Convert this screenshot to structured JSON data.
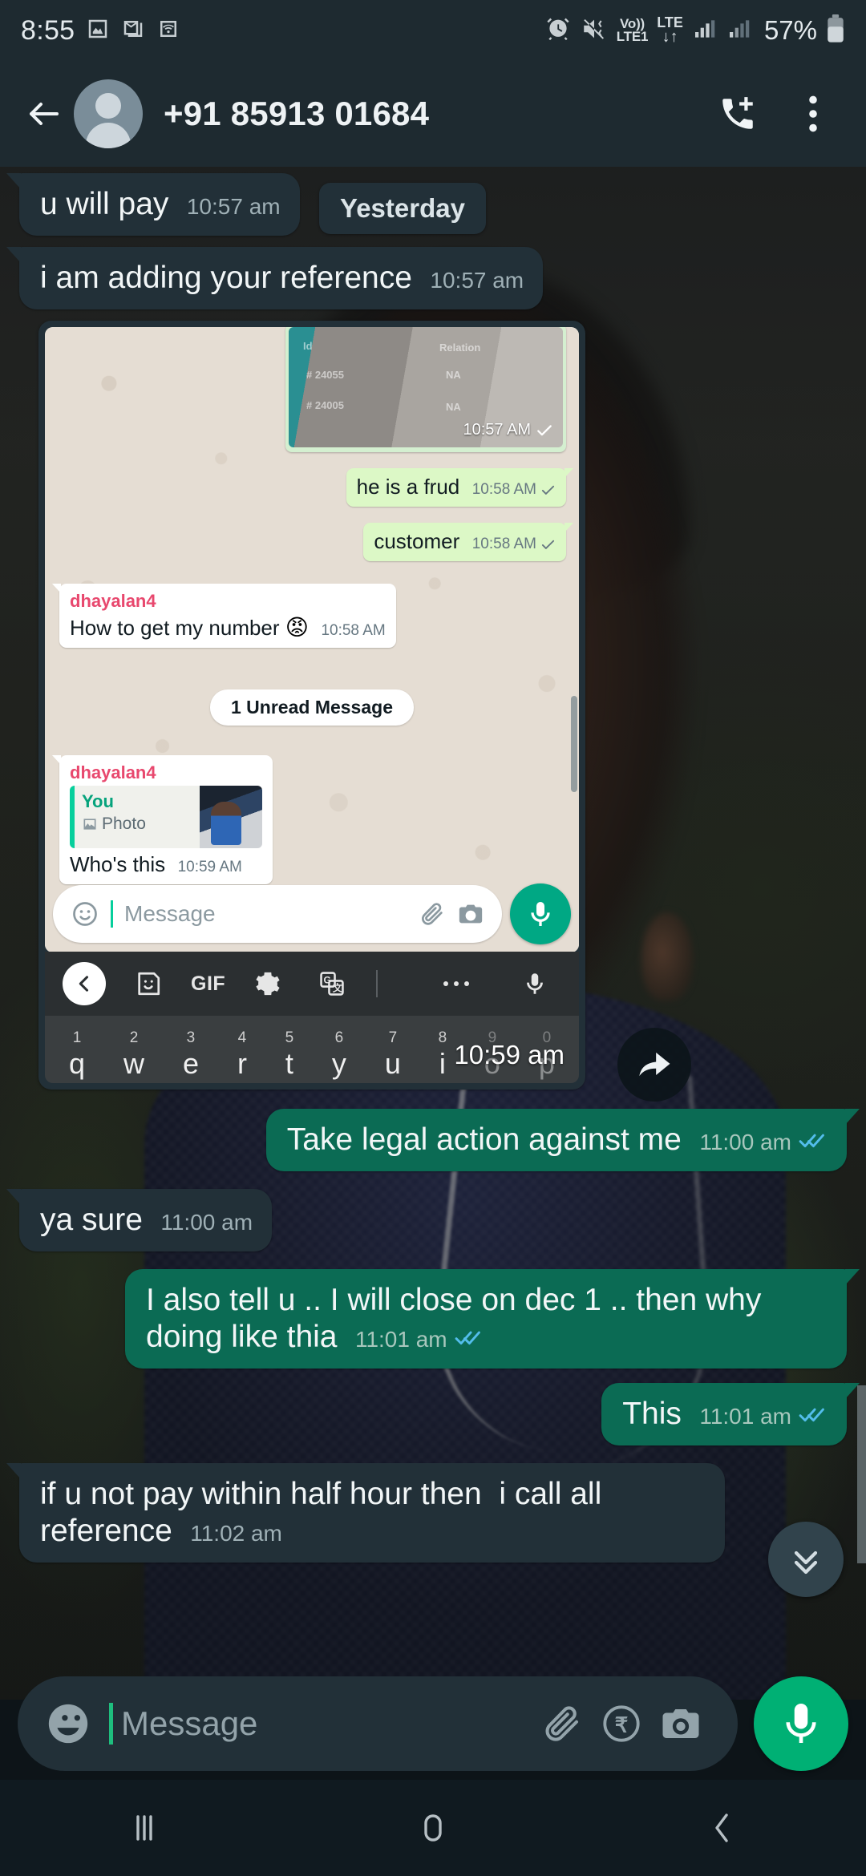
{
  "status_bar": {
    "time": "8:55",
    "icons_left": [
      "gallery-icon",
      "mail-icon",
      "wifi-icon"
    ],
    "icons_right": [
      "alarm-icon",
      "vibrate-icon",
      "volte-icon",
      "lte-data-icon",
      "signal-sim1-icon",
      "signal-sim2-icon"
    ],
    "volte_top": "Vo))",
    "volte_bottom": "LTE1",
    "lte_top": "LTE",
    "battery_percent": "57%"
  },
  "header": {
    "back_icon": "back-arrow-icon",
    "contact_name": "+91 85913 01684",
    "call_icon": "call-add-icon",
    "menu_icon": "overflow-menu-icon"
  },
  "chat": {
    "day_divider": "Yesterday",
    "messages": [
      {
        "id": "m1",
        "dir": "in",
        "text": "u will pay",
        "time": "10:57 am"
      },
      {
        "id": "m2",
        "dir": "in",
        "text": "i am adding your reference",
        "time": "10:57 am"
      },
      {
        "id": "m3",
        "dir": "in",
        "type": "image",
        "time": "10:59 am"
      },
      {
        "id": "m4",
        "dir": "out",
        "text": "Take legal action against me",
        "time": "11:00 am",
        "status": "read"
      },
      {
        "id": "m5",
        "dir": "in",
        "text": "ya sure",
        "time": "11:00 am"
      },
      {
        "id": "m6",
        "dir": "out",
        "text": "I also tell u .. I will close on dec 1 .. then why doing like thia",
        "time": "11:01 am",
        "status": "read"
      },
      {
        "id": "m7",
        "dir": "out",
        "text": "This",
        "time": "11:01 am",
        "status": "read"
      },
      {
        "id": "m8",
        "dir": "in",
        "text": "if u not pay within half hour then  i call all reference",
        "time": "11:02 am"
      }
    ]
  },
  "nested_screenshot": {
    "photo_message": {
      "time": "10:57 AM",
      "status": "sent",
      "labels": [
        "Id",
        "Relation",
        "# 24055",
        "NA",
        "# 24005",
        "NA"
      ]
    },
    "bubbles": [
      {
        "dir": "out",
        "text": "he is a frud",
        "time": "10:58 AM",
        "status": "sent"
      },
      {
        "dir": "out",
        "text": "customer",
        "time": "10:58 AM",
        "status": "sent"
      }
    ],
    "incoming_message": {
      "sender": "dhayalan4",
      "text": "How to get my number ",
      "emoji": "😡",
      "time": "10:58 AM"
    },
    "unread_divider": "1 Unread Message",
    "reply_message": {
      "sender": "dhayalan4",
      "quote_author": "You",
      "quote_type": "Photo",
      "quote_icon": "photo-icon",
      "text": "Who's this",
      "time": "10:59 AM"
    },
    "input_bar": {
      "emoji_icon": "emoji-icon",
      "placeholder": "Message",
      "attach_icon": "attach-icon",
      "camera_icon": "camera-icon",
      "mic_icon": "mic-icon"
    },
    "keyboard_toolbar": {
      "items": [
        "chevron-left-icon",
        "sticker-icon",
        "GIF",
        "gear-icon",
        "translate-icon",
        "more-dots-icon",
        "mic-icon"
      ],
      "gif_label": "GIF"
    },
    "keyboard_row": [
      {
        "letter": "q",
        "num": "1"
      },
      {
        "letter": "w",
        "num": "2"
      },
      {
        "letter": "e",
        "num": "3"
      },
      {
        "letter": "r",
        "num": "4"
      },
      {
        "letter": "t",
        "num": "5"
      },
      {
        "letter": "y",
        "num": "6"
      },
      {
        "letter": "u",
        "num": "7"
      },
      {
        "letter": "i",
        "num": "8"
      },
      {
        "letter": "o",
        "num": "9"
      },
      {
        "letter": "p",
        "num": "0"
      }
    ],
    "forward_icon": "forward-arrow-icon"
  },
  "scroll_down_button": {
    "icon": "double-chevron-down-icon"
  },
  "input_bar": {
    "emoji_icon": "emoji-icon",
    "placeholder": "Message",
    "attach_icon": "attach-icon",
    "payment_icon": "rupee-payment-icon",
    "camera_icon": "camera-icon",
    "mic_icon": "mic-icon"
  },
  "nav_bar": {
    "recents_icon": "recents-icon",
    "home_icon": "home-icon",
    "back_icon": "back-icon"
  },
  "colors": {
    "header_bg": "#1e2a30",
    "incoming_bubble": "#223038",
    "outgoing_bubble": "#0b6b54",
    "accent_green": "#00b074",
    "tick_blue": "#53bdeb",
    "nav_bg": "#101a20"
  }
}
